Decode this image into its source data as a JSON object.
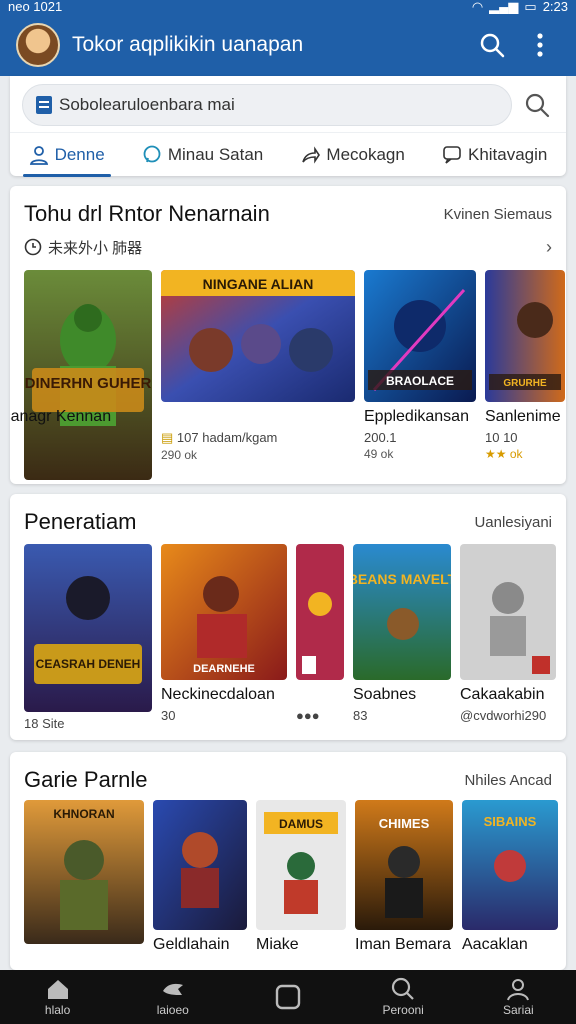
{
  "status_bar": {
    "left": "neo 1021",
    "time": "2:23"
  },
  "app_bar": {
    "title": "Tokor aqplikikin uanapan"
  },
  "search": {
    "value": "Sobolearuloenbara mai"
  },
  "tabs": [
    {
      "label": "Denne",
      "icon": "person-icon"
    },
    {
      "label": "Minau Satan",
      "icon": "chat-icon"
    },
    {
      "label": "Mecokagn",
      "icon": "share-icon"
    },
    {
      "label": "Khitavagin",
      "icon": "message-icon"
    }
  ],
  "sections": [
    {
      "title": "Tohu drl Rntor Nenarnain",
      "more": "Kvinen Siemaus",
      "sub": "未来外小 肺器",
      "cards": [
        {
          "thumb_text": "DINERHN GUHER",
          "name": "Rayjicanagr Kennan",
          "meta": "107 hadam/kgam",
          "meta2": "290 ok"
        },
        {
          "thumb_text": "NINGANE ALIAN",
          "name": "",
          "meta": "",
          "meta2": ""
        },
        {
          "thumb_text": "BRAOLACE",
          "name": "Eppledikansan",
          "meta": "200.1",
          "meta2": "49 ok"
        },
        {
          "thumb_text": "GRURHE",
          "name": "Sanlenime",
          "meta": "10 10",
          "meta2": "★★ ok"
        }
      ]
    },
    {
      "title": "Peneratiam",
      "more": "Uanlesiyani",
      "cards": [
        {
          "thumb_text": "CEASRAH DENEH",
          "name": "",
          "meta": "18 Site",
          "meta2": ""
        },
        {
          "thumb_text": "DEARNEHE",
          "name": "Neckinecdaloan",
          "meta": "30",
          "meta2": ""
        },
        {
          "thumb_text": "",
          "name": "",
          "meta": "",
          "meta2": ""
        },
        {
          "thumb_text": "BEANS MAVELT",
          "name": "Soabnes",
          "meta": "83",
          "meta2": ""
        },
        {
          "thumb_text": "",
          "name": "Cakaakabin",
          "meta": "@cvdworhi290",
          "meta2": ""
        }
      ]
    },
    {
      "title": "Garie Parnle",
      "more": "Nhiles Ancad",
      "cards": [
        {
          "thumb_text": "KHNORAN",
          "name": "",
          "meta": "",
          "meta2": ""
        },
        {
          "thumb_text": "",
          "name": "Geldlahain",
          "meta": "",
          "meta2": ""
        },
        {
          "thumb_text": "DAMUS",
          "name": "Miake",
          "meta": "",
          "meta2": ""
        },
        {
          "thumb_text": "CHIMES",
          "name": "Iman Bemara",
          "meta": "",
          "meta2": ""
        },
        {
          "thumb_text": "SIBAINS",
          "name": "Aacaklan",
          "meta": "",
          "meta2": ""
        }
      ]
    }
  ],
  "bottom_nav": [
    {
      "label": "hlalo",
      "icon": "home-icon"
    },
    {
      "label": "laioeo",
      "icon": "bird-icon"
    },
    {
      "label": "",
      "icon": "square-icon"
    },
    {
      "label": "Perooni",
      "icon": "search-icon"
    },
    {
      "label": "Sariai",
      "icon": "profile-icon"
    }
  ],
  "colors": {
    "brand": "#1f5fa8",
    "bottom_nav": "#111111",
    "background": "#e9ecef"
  }
}
